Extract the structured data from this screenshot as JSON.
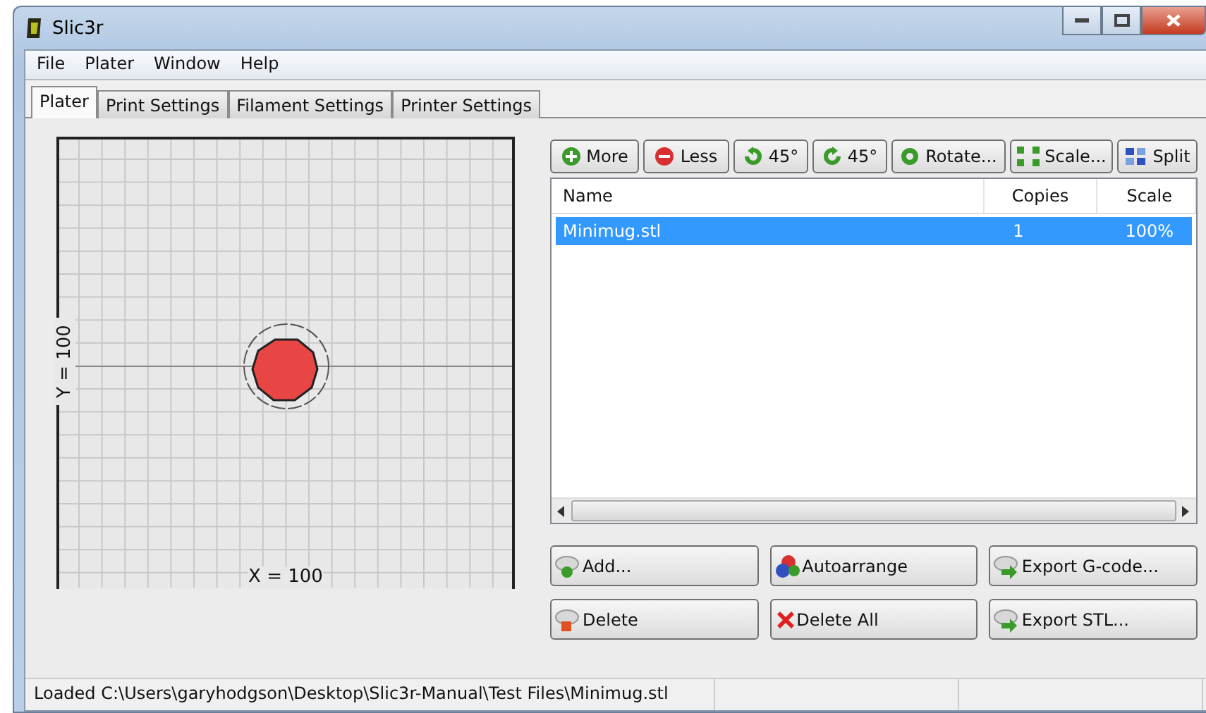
{
  "window": {
    "title": "Slic3r"
  },
  "menu": [
    "File",
    "Plater",
    "Window",
    "Help"
  ],
  "tabs": [
    {
      "label": "Plater",
      "selected": true
    },
    {
      "label": "Print Settings",
      "selected": false
    },
    {
      "label": "Filament Settings",
      "selected": false
    },
    {
      "label": "Printer Settings",
      "selected": false
    }
  ],
  "plate": {
    "x_label": "X = 100",
    "y_label": "Y = 100"
  },
  "toolbar": [
    {
      "kind": "more",
      "label": "More"
    },
    {
      "kind": "less",
      "label": "Less"
    },
    {
      "kind": "rotate_left",
      "label": "45°"
    },
    {
      "kind": "rotate_right",
      "label": "45°"
    },
    {
      "kind": "rotate",
      "label": "Rotate..."
    },
    {
      "kind": "scale",
      "label": "Scale..."
    },
    {
      "kind": "split",
      "label": "Split"
    }
  ],
  "object_list": {
    "columns": [
      "Name",
      "Copies",
      "Scale"
    ],
    "rows": [
      {
        "name": "Minimug.stl",
        "copies": "1",
        "scale": "100%",
        "selected": true
      }
    ]
  },
  "actions": [
    {
      "kind": "add",
      "label": "Add..."
    },
    {
      "kind": "arrange",
      "label": "Autoarrange"
    },
    {
      "kind": "export",
      "label": "Export G-code..."
    },
    {
      "kind": "delete",
      "label": "Delete"
    },
    {
      "kind": "delete_all",
      "label": "Delete All"
    },
    {
      "kind": "export",
      "label": "Export STL..."
    }
  ],
  "status_bar": "Loaded C:\\Users\\garyhodgson\\Desktop\\Slic3r-Manual\\Test Files\\Minimug.stl"
}
